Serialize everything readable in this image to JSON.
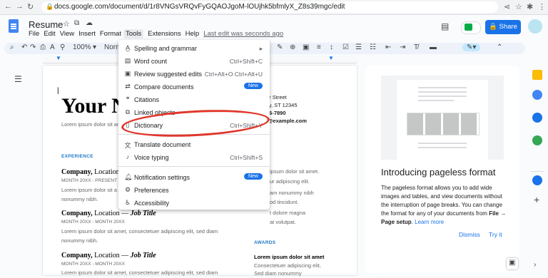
{
  "browser": {
    "url": "docs.google.com/document/d/1r8VNGsVRQvFyGQAOJgoM-lOUjhk5bfmlyX_Z8s39mgc/edit"
  },
  "doc": {
    "title": "Resume",
    "menus": [
      "File",
      "Edit",
      "View",
      "Insert",
      "Format",
      "Tools",
      "Extensions",
      "Help"
    ],
    "last_edit": "Last edit was seconds ago",
    "share_label": "Share"
  },
  "toolbar": {
    "zoom": "100%",
    "style": "Normal"
  },
  "tools_menu": {
    "items": [
      {
        "label": "Spelling and grammar",
        "shortcut": "",
        "icon": "spellcheck-icon"
      },
      {
        "label": "Word count",
        "shortcut": "Ctrl+Shift+C",
        "icon": "word-count-icon"
      },
      {
        "label": "Review suggested edits",
        "shortcut": "Ctrl+Alt+O Ctrl+Alt+U",
        "icon": "review-icon"
      },
      {
        "label": "Compare documents",
        "shortcut": "",
        "badge": "New",
        "icon": "compare-icon"
      },
      {
        "label": "Citations",
        "shortcut": "",
        "icon": "quote-icon"
      },
      {
        "label": "Linked objects",
        "shortcut": "",
        "icon": "link-icon"
      },
      {
        "label": "Dictionary",
        "shortcut": "Ctrl+Shift+Y",
        "icon": "book-icon"
      },
      {
        "label": "Translate document",
        "shortcut": "",
        "icon": "translate-icon"
      },
      {
        "label": "Voice typing",
        "shortcut": "Ctrl+Shift+S",
        "icon": "mic-icon"
      },
      {
        "label": "Notification settings",
        "shortcut": "",
        "badge": "New",
        "icon": "bell-icon"
      },
      {
        "label": "Preferences",
        "shortcut": "",
        "icon": "preferences-icon"
      },
      {
        "label": "Accessibility",
        "shortcut": "",
        "icon": "accessibility-icon"
      }
    ]
  },
  "document_body": {
    "heading": "Your N",
    "lorem_line": "Lorem ipsum dolor sit am",
    "address1": "ur Street",
    "address2": "ity, ST 12345",
    "phone": "56-7890",
    "email": "l@example.com",
    "experience_label": "EXPERIENCE",
    "awards_label": "AWARDS",
    "jobs": [
      {
        "company": "Company,",
        "rest": " Location",
        "role": "",
        "dates": "MONTH 20XX - PRESENT",
        "lines": [
          "Lorem ipsum dolor sit a",
          "nonummy nibh."
        ]
      },
      {
        "company": "Company,",
        "rest": " Location — ",
        "role": "Job Title",
        "dates": "MONTH 20XX - MONTH 20XX",
        "lines": [
          "Lorem ipsum dolor sit amet, consectetuer adipiscing elit, sed diam",
          "nonummy nibh."
        ]
      },
      {
        "company": "Company,",
        "rest": " Location — ",
        "role": "Job Title",
        "dates": "MONTH 20XX - MONTH 20XX",
        "lines": [
          "Lorem ipsum dolor sit amet, consectetuer adipiscing elit, sed diam"
        ]
      }
    ],
    "right_col": [
      "ipsum dolor sit amet.",
      "ur adipiscing elit.",
      "am nonummy nibh",
      "od tincidunt.",
      "t dolore magna",
      "at volutpat."
    ],
    "awards_lines": [
      "Lorem ipsum dolor sit amet",
      "Consectetuer adipiscing elit,",
      "Sed diam nonummy"
    ]
  },
  "side_panel": {
    "title": "Introducing pageless format",
    "body_pre": "The pageless format allows you to add wide images and tables, and view documents without the interruption of page breaks. You can change the format for any of your documents from ",
    "body_bold": "File → Page setup",
    "body_post": ". ",
    "learn_more": "Learn more",
    "dismiss": "Dismiss",
    "try_it": "Try it"
  }
}
